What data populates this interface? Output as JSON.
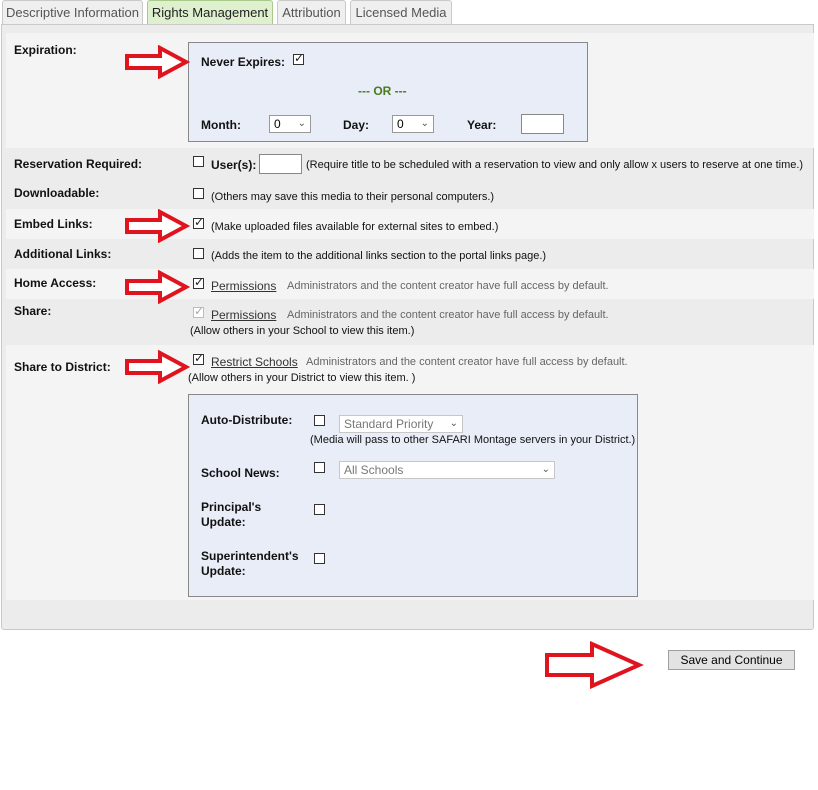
{
  "tabs": [
    {
      "label": "Descriptive Information"
    },
    {
      "label": "Rights Management"
    },
    {
      "label": "Attribution"
    },
    {
      "label": "Licensed Media"
    }
  ],
  "expiration": {
    "label": "Expiration:",
    "never_expires_label": "Never Expires:",
    "never_expires_checked": true,
    "or_text": "--- OR ---",
    "month_label": "Month:",
    "month_value": "0",
    "day_label": "Day:",
    "day_value": "0",
    "year_label": "Year:",
    "year_value": ""
  },
  "reservation": {
    "label": "Reservation Required:",
    "users_label": "User(s):",
    "users_value": "",
    "note": "(Require title to be scheduled with a reservation to view and only allow x users to reserve at one time.)"
  },
  "downloadable": {
    "label": "Downloadable:",
    "note": "(Others may save this media to their personal computers.)"
  },
  "embed": {
    "label": "Embed Links:",
    "note": "(Make uploaded files available for external sites to embed.)"
  },
  "additional": {
    "label": "Additional Links:",
    "note": "(Adds the item to the additional links section to the portal links page.)"
  },
  "home_access": {
    "label": "Home Access:",
    "link": "Permissions",
    "note": "Administrators and the content creator have full access by default."
  },
  "share": {
    "label": "Share:",
    "link": "Permissions",
    "note": "Administrators and the content creator have full access by default.",
    "note2": "(Allow others in your School to view this item.)"
  },
  "share_district": {
    "label": "Share to District:",
    "link": "Restrict Schools",
    "note": "Administrators and the content creator have full access by default.",
    "note2": "(Allow others in your District to view this item. )"
  },
  "district_box": {
    "auto_distribute_label": "Auto-Distribute:",
    "auto_distribute_select": "Standard Priority",
    "auto_distribute_note": "(Media will pass to other SAFARI Montage servers in your District.)",
    "school_news_label": "School News:",
    "school_news_select": "All Schools",
    "principal_label_1": "Principal's",
    "principal_label_2": "Update:",
    "superintendent_label_1": "Superintendent's",
    "superintendent_label_2": "Update:"
  },
  "footer": {
    "save_label": "Save and Continue"
  },
  "colors": {
    "arrow": "#e0141e",
    "or_green": "#4a7a1c",
    "box_bg": "#e8edf8",
    "active_tab_bg": "#dff0cf"
  }
}
